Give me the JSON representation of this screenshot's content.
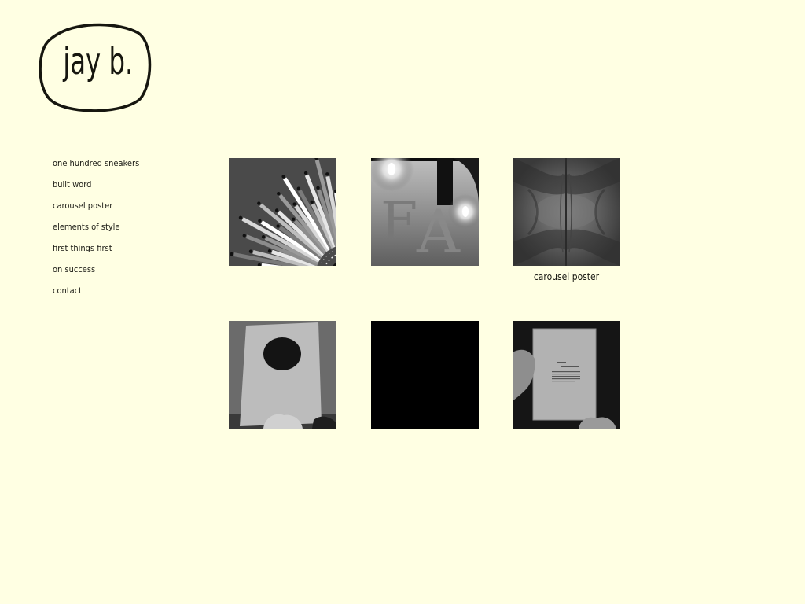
{
  "logo": {
    "text": "jay b.",
    "icon": "handwritten-circle-logo"
  },
  "nav": {
    "items": [
      {
        "label": "one hundred sneakers"
      },
      {
        "label": "built word"
      },
      {
        "label": "carousel poster"
      },
      {
        "label": "elements of style"
      },
      {
        "label": "first things first"
      },
      {
        "label": "on success"
      }
    ],
    "contact": "contact"
  },
  "gallery": {
    "thumbnails": [
      {
        "project": "one hundred sneakers",
        "icon": "radial-sneaker-chart-image"
      },
      {
        "project": "built word",
        "icon": "candle-letters-image"
      },
      {
        "project": "carousel poster",
        "icon": "mirrored-abstract-image"
      },
      {
        "project": "elements of style",
        "icon": "paper-with-ink-blot-image"
      },
      {
        "project": "first things first",
        "icon": "black-square-image"
      },
      {
        "project": "on success",
        "icon": "hand-holding-page-image"
      }
    ],
    "hover_caption": "carousel poster"
  },
  "colors": {
    "background": "#ffffe3",
    "text": "#1a1a14"
  }
}
